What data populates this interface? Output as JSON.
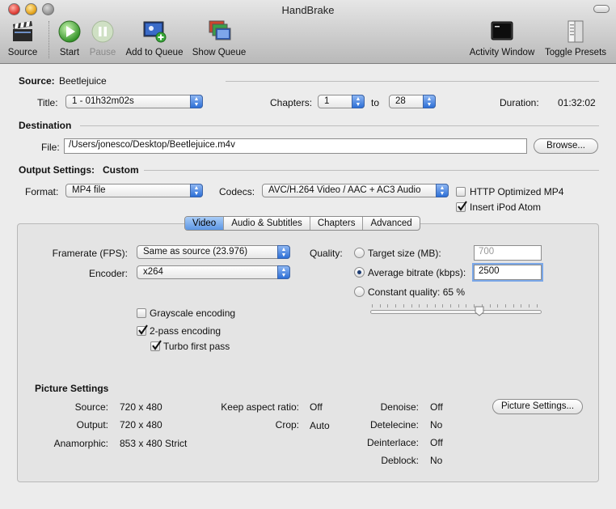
{
  "window": {
    "title": "HandBrake"
  },
  "toolbar": {
    "source": "Source",
    "start": "Start",
    "pause": "Pause",
    "add_queue": "Add to Queue",
    "show_queue": "Show Queue",
    "activity": "Activity Window",
    "toggle_presets": "Toggle Presets"
  },
  "source": {
    "label": "Source:",
    "value": "Beetlejuice"
  },
  "title_row": {
    "title_label": "Title:",
    "title_value": "1 - 01h32m02s",
    "chapters_label": "Chapters:",
    "chapter_from": "1",
    "to_label": "to",
    "chapter_to": "28",
    "duration_label": "Duration:",
    "duration_value": "01:32:02"
  },
  "destination": {
    "heading": "Destination",
    "file_label": "File:",
    "file_value": "/Users/jonesco/Desktop/Beetlejuice.m4v",
    "browse": "Browse..."
  },
  "output": {
    "heading": "Output Settings:",
    "preset": "Custom",
    "format_label": "Format:",
    "format_value": "MP4 file",
    "codecs_label": "Codecs:",
    "codecs_value": "AVC/H.264 Video / AAC + AC3 Audio",
    "http_opt": "HTTP Optimized MP4",
    "http_checked": false,
    "ipod": "Insert iPod Atom",
    "ipod_checked": true
  },
  "tabs": [
    "Video",
    "Audio & Subtitles",
    "Chapters",
    "Advanced"
  ],
  "selected_tab": "Video",
  "video": {
    "framerate_label": "Framerate (FPS):",
    "framerate_value": "Same as source (23.976)",
    "encoder_label": "Encoder:",
    "encoder_value": "x264",
    "grayscale": "Grayscale encoding",
    "grayscale_checked": false,
    "twopass": "2-pass encoding",
    "twopass_checked": true,
    "turbo": "Turbo first pass",
    "turbo_checked": true,
    "quality_label": "Quality:",
    "target_size": "Target size (MB):",
    "target_size_value": "700",
    "avg_bitrate": "Average bitrate (kbps):",
    "avg_bitrate_value": "2500",
    "constant_quality": "Constant quality: 65 %",
    "selected_quality_mode": "Average bitrate (kbps):",
    "quality_slider_value": 0.65
  },
  "picture": {
    "heading": "Picture Settings",
    "source_label": "Source:",
    "source_value": "720 x 480",
    "output_label": "Output:",
    "output_value": "720 x 480",
    "anamorphic_label": "Anamorphic:",
    "anamorphic_value": "853 x 480 Strict",
    "keep_aspect_label": "Keep aspect ratio:",
    "keep_aspect_value": "Off",
    "crop_label": "Crop:",
    "crop_value": "Auto",
    "denoise_label": "Denoise:",
    "denoise_value": "Off",
    "detelecine_label": "Detelecine:",
    "detelecine_value": "No",
    "deinterlace_label": "Deinterlace:",
    "deinterlace_value": "Off",
    "deblock_label": "Deblock:",
    "deblock_value": "No",
    "button": "Picture Settings..."
  },
  "colors": {
    "accent": "#2d6fd6",
    "start_green": "#3aa83a"
  }
}
